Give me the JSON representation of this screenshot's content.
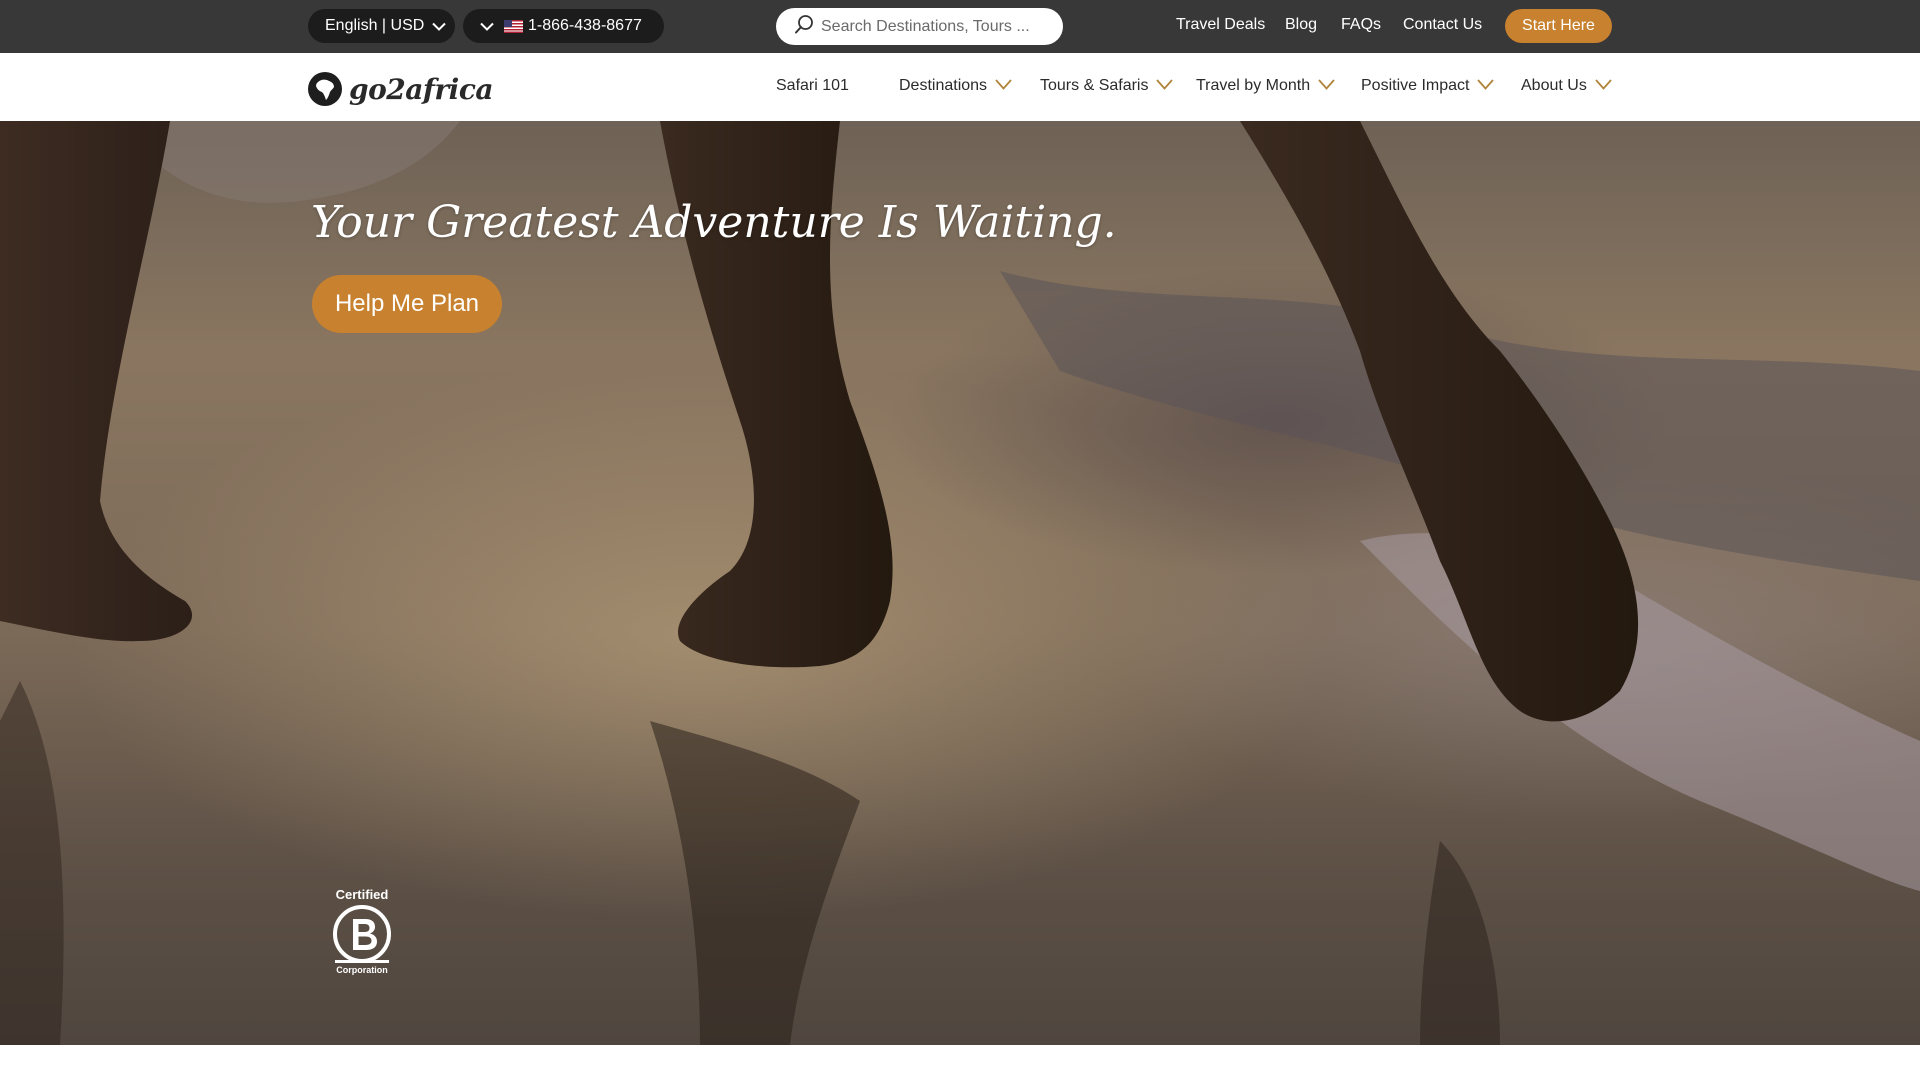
{
  "topbar": {
    "language_currency": "English | USD",
    "phone": "1-866-438-8677",
    "search_placeholder": "Search Destinations, Tours ...",
    "links": [
      "Travel Deals",
      "Blog",
      "FAQs",
      "Contact Us"
    ],
    "cta_label": "Start Here"
  },
  "brand": {
    "name": "go2africa"
  },
  "nav": {
    "items": [
      {
        "label": "Safari 101",
        "has_dropdown": false
      },
      {
        "label": "Destinations",
        "has_dropdown": true
      },
      {
        "label": "Tours & Safaris",
        "has_dropdown": true
      },
      {
        "label": "Travel by Month",
        "has_dropdown": true
      },
      {
        "label": "Positive Impact",
        "has_dropdown": true
      },
      {
        "label": "About Us",
        "has_dropdown": true
      }
    ]
  },
  "hero": {
    "headline": "Your Greatest Adventure Is Waiting.",
    "cta_label": "Help Me Plan",
    "badge": {
      "top": "Certified",
      "bottom": "Corporation"
    }
  },
  "icons": {
    "search": "search-icon",
    "chevron": "chevron-down-icon",
    "flag": "us-flag-icon",
    "logo": "africa-globe-logo-icon",
    "badge": "b-corp-icon"
  },
  "colors": {
    "topbar_bg": "#383838",
    "pill_bg": "#1c1c1c",
    "accent": "#c7812f",
    "nav_chevron": "#b0843c",
    "nav_text": "#2b2b2b"
  }
}
